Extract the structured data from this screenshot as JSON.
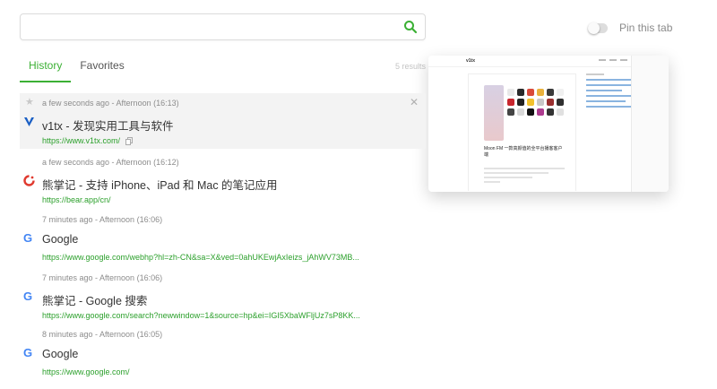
{
  "search": {
    "value": "",
    "placeholder": ""
  },
  "pin": {
    "label": "Pin this tab",
    "enabled": false
  },
  "tabs": [
    {
      "label": "History",
      "active": true
    },
    {
      "label": "Favorites",
      "active": false
    }
  ],
  "results_count": "5 results",
  "preview": {
    "site_logo": "v1tx",
    "article_title": "Moon FM 一款高颜值的全平台播客客户端"
  },
  "items": [
    {
      "time": "a few seconds ago - Afternoon (16:13)",
      "title": "v1tx - 发现实用工具与软件",
      "url": "https://www.v1tx.com/",
      "favicon": "v1tx-icon",
      "hovered": true
    },
    {
      "time": "a few seconds ago - Afternoon (16:12)",
      "title": "熊掌记 - 支持 iPhone、iPad 和 Mac 的笔记应用",
      "url": "https://bear.app/cn/",
      "favicon": "bear-icon",
      "hovered": false
    },
    {
      "time": "7 minutes ago - Afternoon (16:06)",
      "title": "Google",
      "url": "https://www.google.com/webhp?hl=zh-CN&sa=X&ved=0ahUKEwjAxIeizs_jAhWV73MB...",
      "favicon": "google-icon",
      "hovered": false
    },
    {
      "time": "7 minutes ago - Afternoon (16:06)",
      "title": "熊掌记 - Google 搜索",
      "url": "https://www.google.com/search?newwindow=1&source=hp&ei=IGI5XbaWFljUz7sP8KK...",
      "favicon": "google-icon",
      "hovered": false
    },
    {
      "time": "8 minutes ago - Afternoon (16:05)",
      "title": "Google",
      "url": "https://www.google.com/",
      "favicon": "google-icon",
      "hovered": false
    }
  ],
  "colors": {
    "accent": "#3bb034",
    "url": "#2ca02c",
    "meta": "#8c8c8c",
    "hover_bg": "#f3f3f3"
  }
}
